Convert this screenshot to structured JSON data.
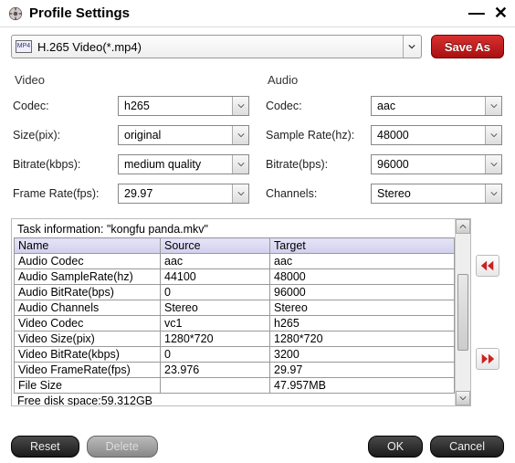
{
  "window": {
    "title": "Profile Settings"
  },
  "profile": {
    "selected": "H.265 Video(*.mp4)",
    "format_badge": "MP4"
  },
  "buttons": {
    "save_as": "Save As",
    "reset": "Reset",
    "delete": "Delete",
    "ok": "OK",
    "cancel": "Cancel"
  },
  "video": {
    "heading": "Video",
    "codec_label": "Codec:",
    "codec": "h265",
    "size_label": "Size(pix):",
    "size": "original",
    "bitrate_label": "Bitrate(kbps):",
    "bitrate": "medium quality",
    "fps_label": "Frame Rate(fps):",
    "fps": "29.97"
  },
  "audio": {
    "heading": "Audio",
    "codec_label": "Codec:",
    "codec": "aac",
    "sr_label": "Sample Rate(hz):",
    "sr": "48000",
    "bitrate_label": "Bitrate(bps):",
    "bitrate": "96000",
    "ch_label": "Channels:",
    "ch": "Stereo"
  },
  "task": {
    "caption": "Task information: \"kongfu panda.mkv\"",
    "headers": {
      "name": "Name",
      "source": "Source",
      "target": "Target"
    },
    "rows": [
      {
        "name": "Audio Codec",
        "source": "aac",
        "target": "aac"
      },
      {
        "name": "Audio SampleRate(hz)",
        "source": "44100",
        "target": "48000"
      },
      {
        "name": "Audio BitRate(bps)",
        "source": "0",
        "target": "96000"
      },
      {
        "name": "Audio Channels",
        "source": "Stereo",
        "target": "Stereo"
      },
      {
        "name": "Video Codec",
        "source": "vc1",
        "target": "h265"
      },
      {
        "name": "Video Size(pix)",
        "source": "1280*720",
        "target": "1280*720"
      },
      {
        "name": "Video BitRate(kbps)",
        "source": "0",
        "target": "3200"
      },
      {
        "name": "Video FrameRate(fps)",
        "source": "23.976",
        "target": "29.97"
      },
      {
        "name": "File Size",
        "source": "",
        "target": "47.957MB"
      }
    ],
    "free_disk": "Free disk space:59.312GB"
  }
}
